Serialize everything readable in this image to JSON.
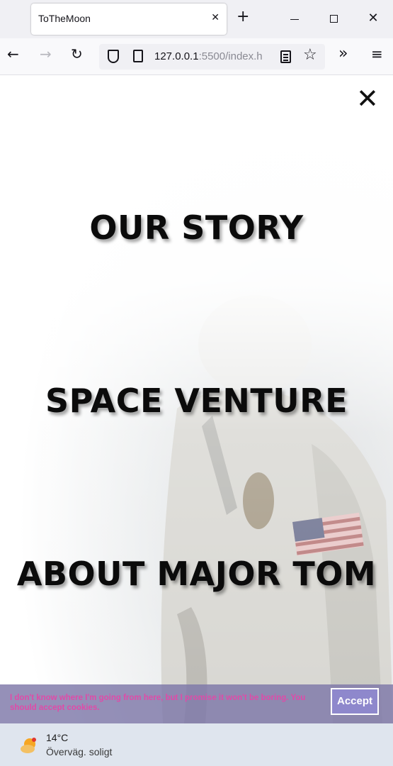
{
  "browser": {
    "tab_title": "ToTheMoon",
    "url_host": "127.0.0.1",
    "url_rest": ":5500/index.h"
  },
  "menu": {
    "items": [
      {
        "label": "OUR STORY"
      },
      {
        "label": "SPACE VENTURE"
      },
      {
        "label": "ABOUT MAJOR TOM"
      }
    ]
  },
  "cookie_banner": {
    "message": "I don't know where I'm going from here, but I promise it won't be boring. You should accept cookies.",
    "accept_label": "Accept"
  },
  "taskbar": {
    "temperature": "14°C",
    "condition": "Överväg. soligt"
  },
  "icons": {
    "close_menu": "close-icon",
    "weather": "partly-sunny-icon"
  }
}
